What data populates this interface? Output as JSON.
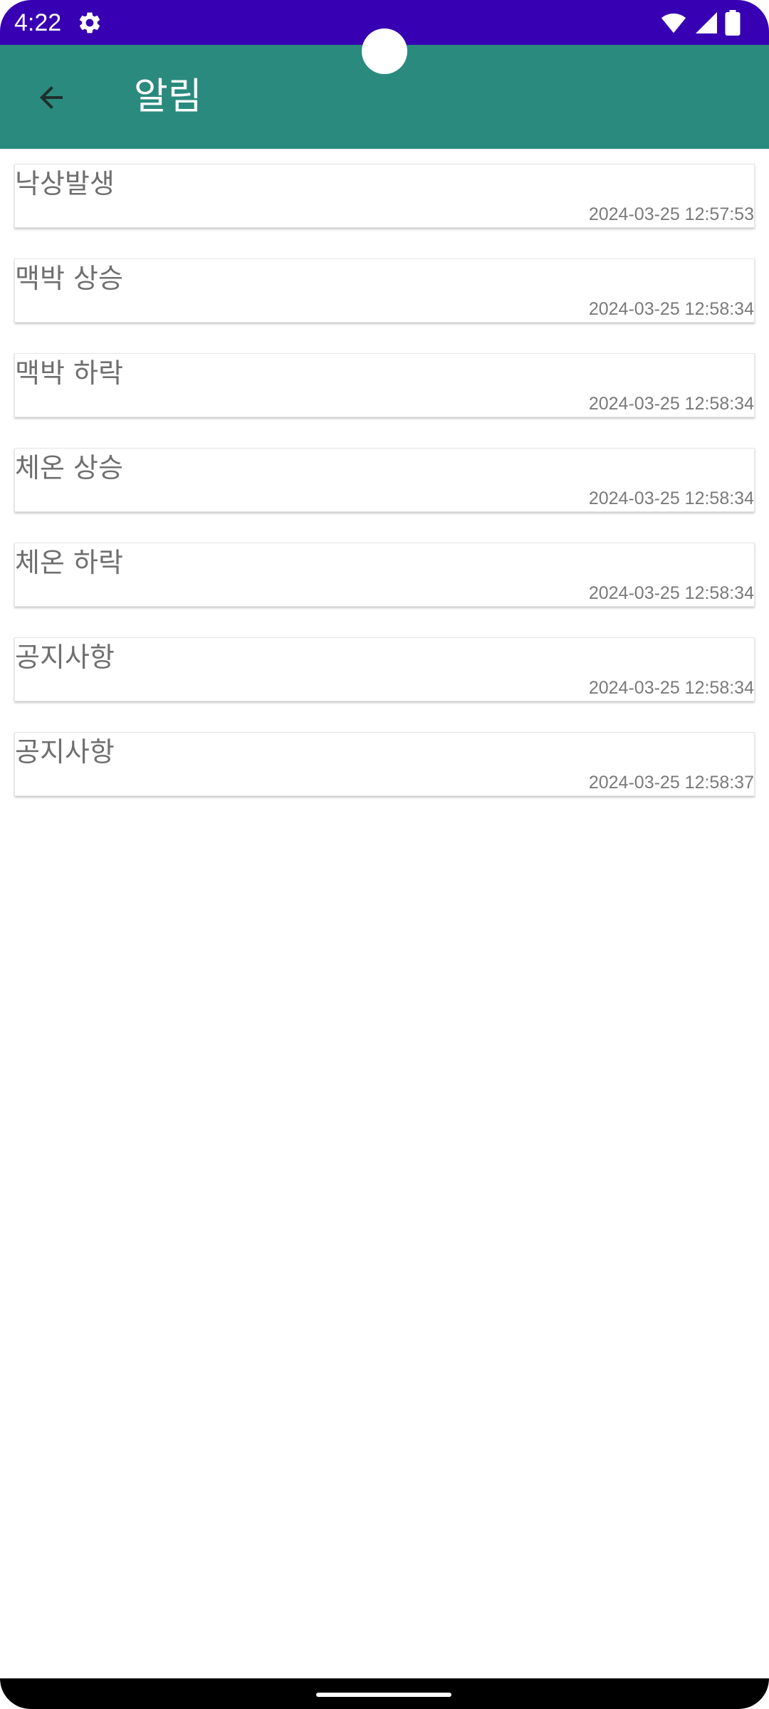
{
  "status_bar": {
    "time": "4:22",
    "icons": [
      "gear-icon",
      "wifi-icon",
      "signal-icon",
      "battery-icon"
    ],
    "background": "#3700b3"
  },
  "app_bar": {
    "title": "알림",
    "back_icon": "arrow-back-icon",
    "background": "#2a8a7e"
  },
  "notifications": [
    {
      "title": "낙상발생",
      "time": "2024-03-25 12:57:53"
    },
    {
      "title": "맥박 상승",
      "time": "2024-03-25 12:58:34"
    },
    {
      "title": "맥박 하락",
      "time": "2024-03-25 12:58:34"
    },
    {
      "title": "체온 상승",
      "time": "2024-03-25 12:58:34"
    },
    {
      "title": "체온 하락",
      "time": "2024-03-25 12:58:34"
    },
    {
      "title": "공지사항",
      "time": "2024-03-25 12:58:34"
    },
    {
      "title": "공지사항",
      "time": "2024-03-25 12:58:37"
    }
  ]
}
